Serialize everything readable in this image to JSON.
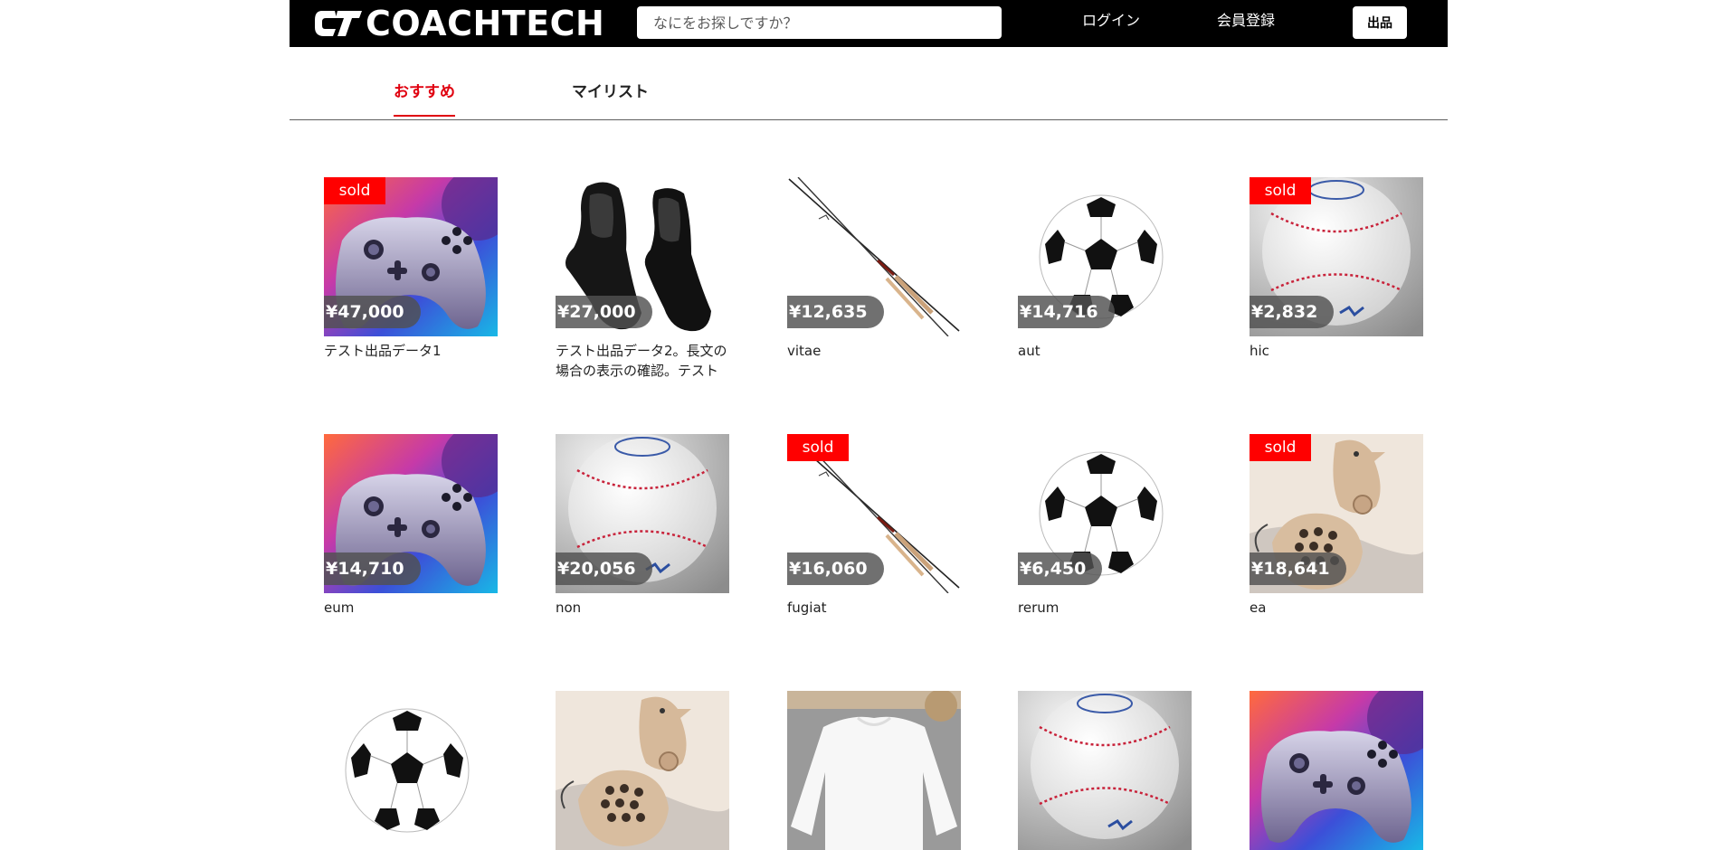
{
  "header": {
    "logo_text": "COACHTECH",
    "search_placeholder": "なにをお探しですか？",
    "login_label": "ログイン",
    "register_label": "会員登録",
    "sell_label": "出品"
  },
  "tabs": [
    {
      "label": "おすすめ",
      "active": true
    },
    {
      "label": "マイリスト",
      "active": false
    }
  ],
  "colors": {
    "accent": "#ff0000",
    "header_bg": "#000000"
  },
  "products": [
    {
      "name": "テスト出品データ1",
      "price": "¥47,000",
      "sold": true,
      "image": "controller"
    },
    {
      "name": "テスト出品データ2。長文の場合の表示の確認。テスト",
      "price": "¥27,000",
      "sold": false,
      "image": "shoes"
    },
    {
      "name": "vitae",
      "price": "¥12,635",
      "sold": false,
      "image": "rod"
    },
    {
      "name": "aut",
      "price": "¥14,716",
      "sold": false,
      "image": "soccer"
    },
    {
      "name": "hic",
      "price": "¥2,832",
      "sold": true,
      "image": "baseball"
    },
    {
      "name": "eum",
      "price": "¥14,710",
      "sold": false,
      "image": "controller"
    },
    {
      "name": "non",
      "price": "¥20,056",
      "sold": false,
      "image": "baseball"
    },
    {
      "name": "fugiat",
      "price": "¥16,060",
      "sold": true,
      "image": "rod"
    },
    {
      "name": "rerum",
      "price": "¥6,450",
      "sold": false,
      "image": "soccer"
    },
    {
      "name": "ea",
      "price": "¥18,641",
      "sold": true,
      "image": "phone"
    },
    {
      "name": "",
      "price": "",
      "sold": false,
      "image": "soccer"
    },
    {
      "name": "",
      "price": "",
      "sold": false,
      "image": "phone"
    },
    {
      "name": "",
      "price": "",
      "sold": false,
      "image": "sweater"
    },
    {
      "name": "",
      "price": "",
      "sold": false,
      "image": "baseball"
    },
    {
      "name": "",
      "price": "",
      "sold": false,
      "image": "controller"
    }
  ],
  "labels": {
    "sold": "sold"
  }
}
